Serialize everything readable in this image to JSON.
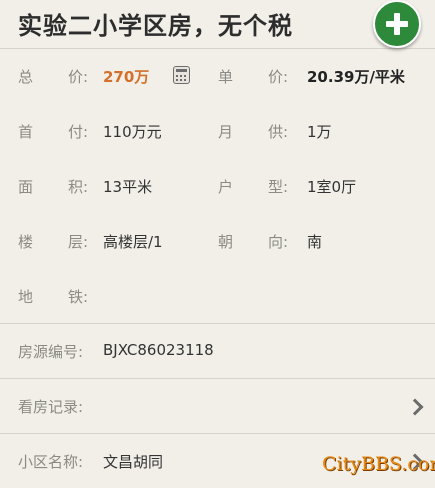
{
  "header": {
    "title": "实验二小学区房，无个税",
    "add_icon": "plus-circle-icon"
  },
  "details": {
    "total_price": {
      "label_a": "总",
      "label_b": "价:",
      "value": "270万"
    },
    "unit_price": {
      "label_a": "单",
      "label_b": "价:",
      "value": "20.39万/平米"
    },
    "down_payment": {
      "label_a": "首",
      "label_b": "付:",
      "value": "110万元"
    },
    "monthly_payment": {
      "label_a": "月",
      "label_b": "供:",
      "value": "1万"
    },
    "area": {
      "label_a": "面",
      "label_b": "积:",
      "value": "13平米"
    },
    "layout": {
      "label_a": "户",
      "label_b": "型:",
      "value": "1室0厅"
    },
    "floor": {
      "label_a": "楼",
      "label_b": "层:",
      "value": "高楼层/1"
    },
    "orientation": {
      "label_a": "朝",
      "label_b": "向:",
      "value": "南"
    },
    "subway": {
      "label_a": "地",
      "label_b": "铁:",
      "value": ""
    },
    "listing_id": {
      "label": "房源编号:",
      "value": "BJXC86023118"
    },
    "viewing_record": {
      "label": "看房记录:"
    },
    "community": {
      "label": "小区名称:",
      "value": "文昌胡同"
    }
  },
  "watermark": "CityBBS.com",
  "colors": {
    "price": "#d4702a",
    "add_button": "#2d8a3a",
    "background": "#f1efe8"
  }
}
